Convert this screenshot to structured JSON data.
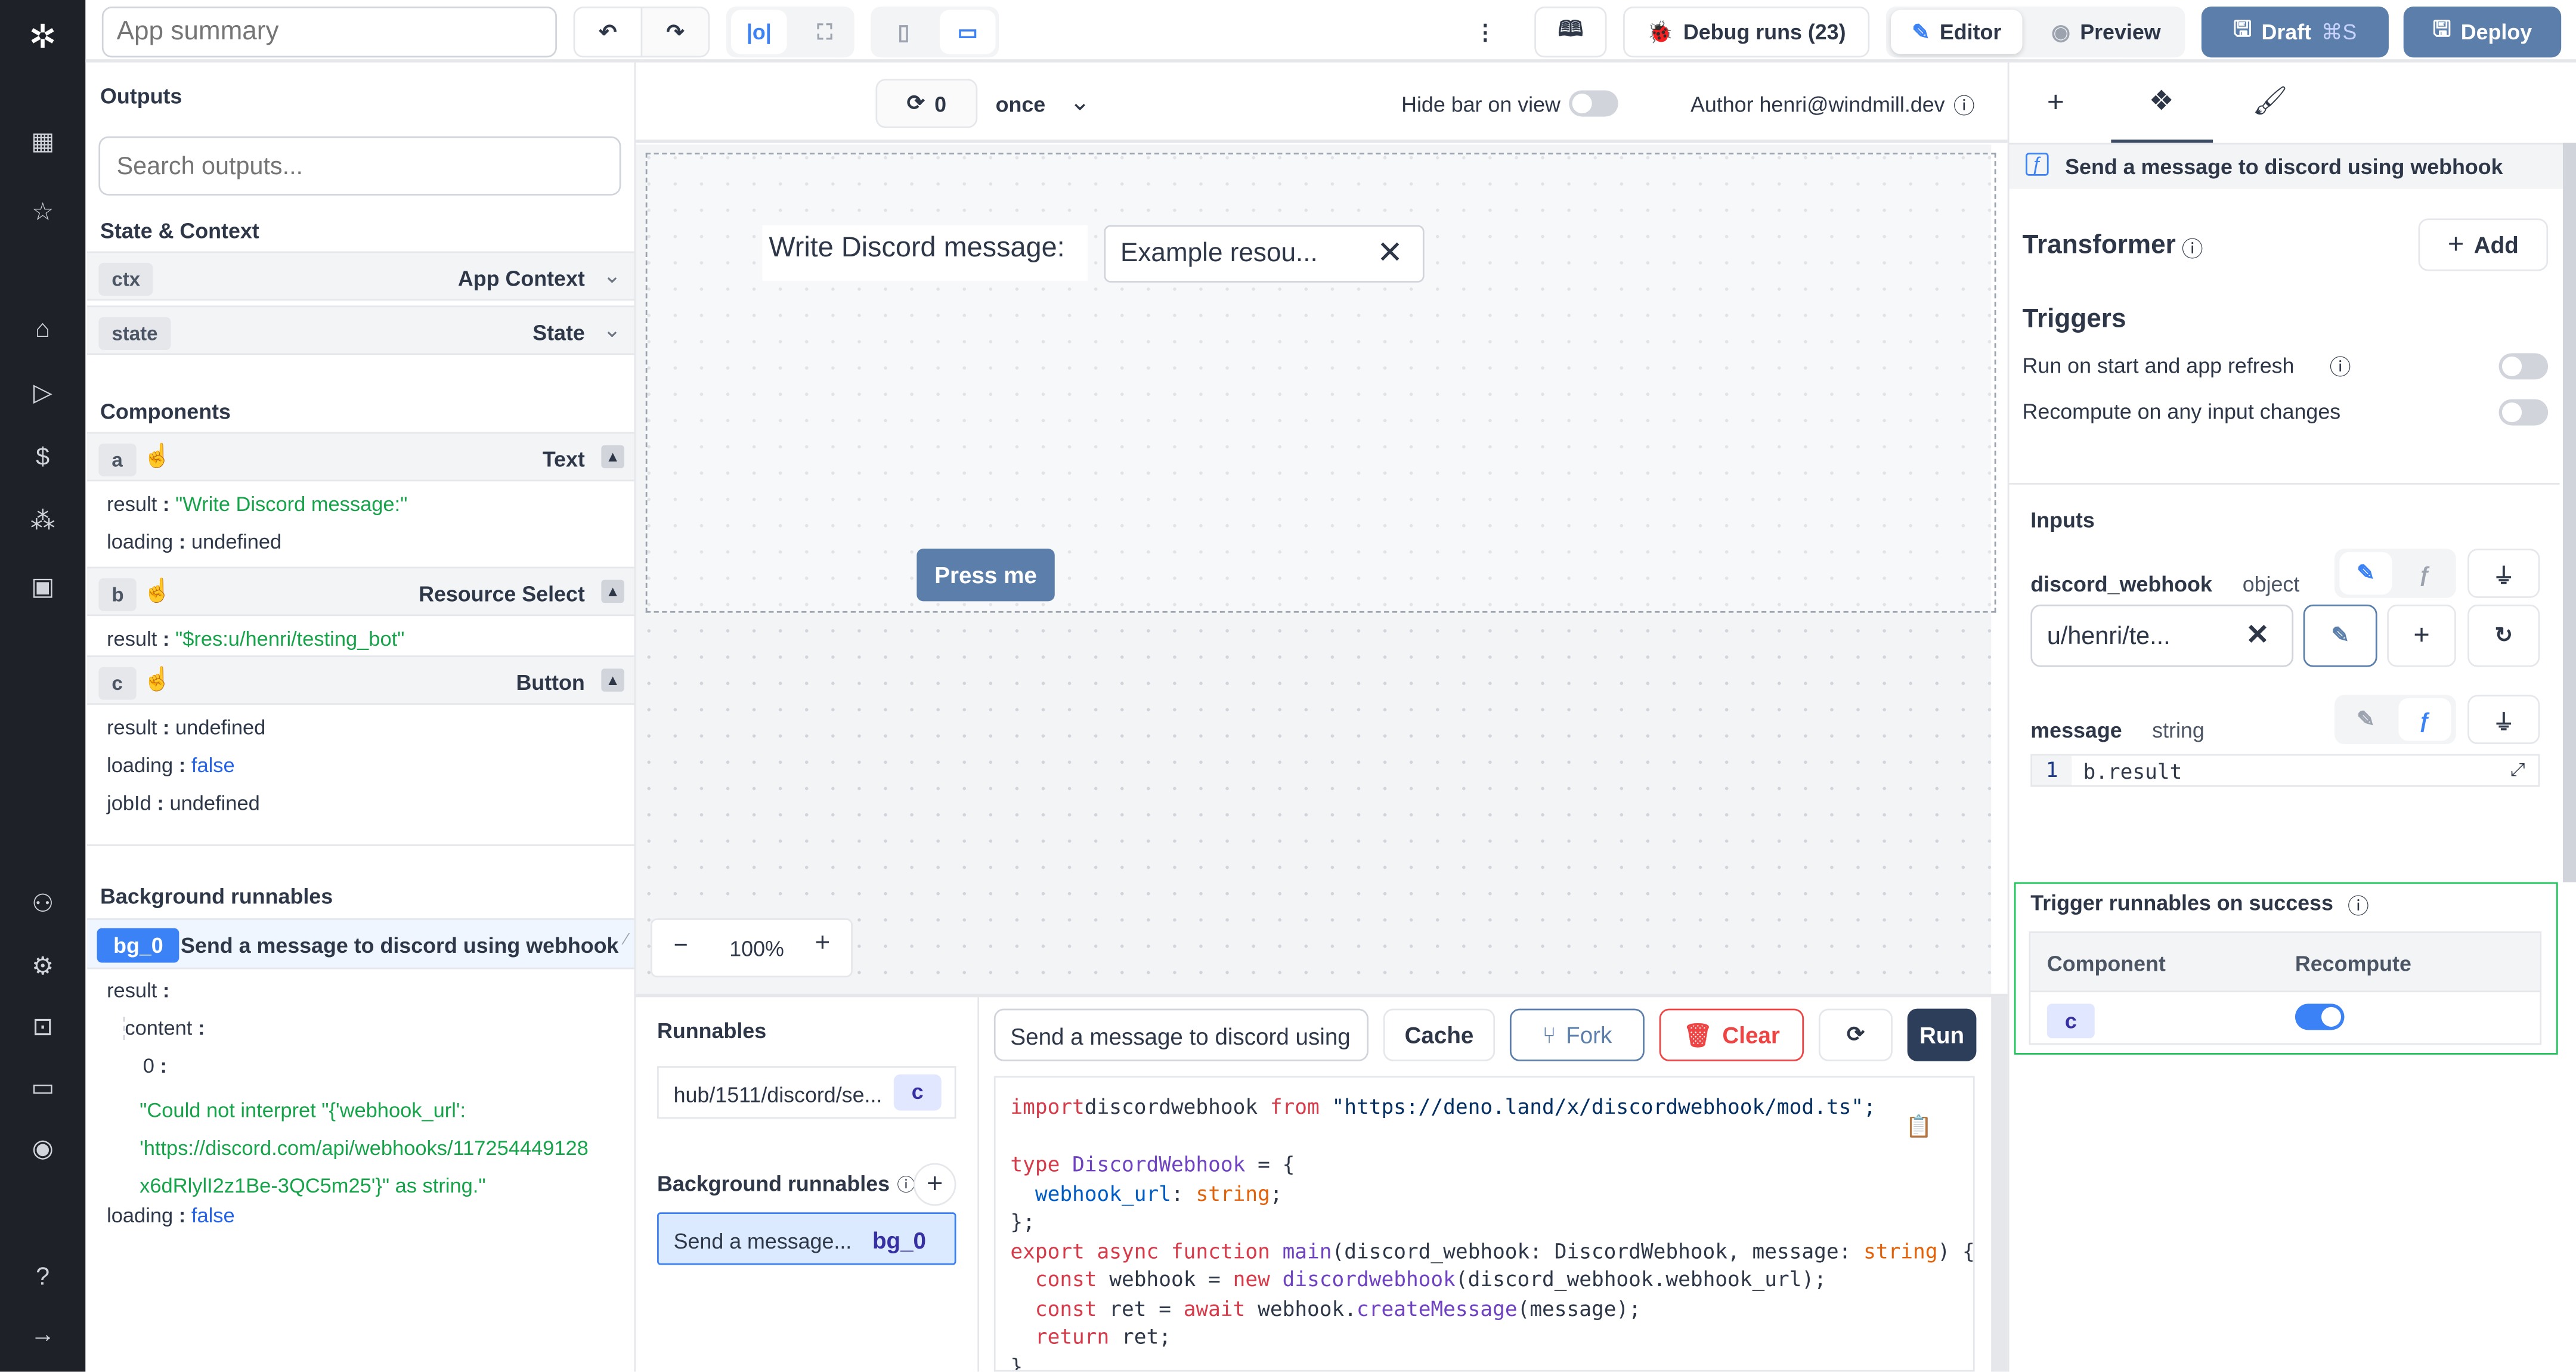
{
  "colors": {
    "accent": "#3b82f6",
    "draft": "#5b7faa",
    "nav_bg": "#1f2128",
    "success_border": "#22c55e",
    "danger": "#ef4444"
  },
  "topbar": {
    "app_summary_placeholder": "App summary",
    "debug_runs": "Debug runs (23)",
    "editor": "Editor",
    "preview": "Preview",
    "draft": "Draft",
    "draft_shortcut": "⌘S",
    "deploy": "Deploy"
  },
  "outputs": {
    "title": "Outputs",
    "search_placeholder": "Search outputs...",
    "state_context": "State & Context",
    "ctx": {
      "id": "ctx",
      "label": "App Context"
    },
    "state": {
      "id": "state",
      "label": "State"
    },
    "components_title": "Components",
    "components": [
      {
        "id": "a",
        "type": "Text",
        "fields": [
          {
            "k": "result",
            "v": "\"Write Discord message:\"",
            "c": "green"
          },
          {
            "k": "loading",
            "v": "undefined",
            "c": ""
          }
        ]
      },
      {
        "id": "b",
        "type": "Resource Select",
        "fields": [
          {
            "k": "result",
            "v": "\"$res:u/henri/testing_bot\"",
            "c": "green"
          }
        ]
      },
      {
        "id": "c",
        "type": "Button",
        "fields": [
          {
            "k": "result",
            "v": "undefined",
            "c": ""
          },
          {
            "k": "loading",
            "v": "false",
            "c": "blue"
          },
          {
            "k": "jobId",
            "v": "undefined",
            "c": ""
          }
        ]
      }
    ],
    "bg_title": "Background runnables",
    "bg": {
      "id": "bg_0",
      "name": "Send a message to discord using webhook",
      "result_key": "result",
      "content_key": "content",
      "index_key": "0",
      "error_lines": [
        "\"Could not interpret \"{'webhook_url':",
        "'https://discord.com/api/webhooks/117254449128",
        "x6dRlylI2z1Be-3QC5m25'}\" as string.\""
      ],
      "loading_key": "loading",
      "loading_val": "false"
    }
  },
  "canvas": {
    "refresh_count": "0",
    "frequency": "once",
    "hide_bar_label": "Hide bar on view",
    "hide_bar_on": false,
    "author": "Author henri@windmill.dev",
    "text_component": "Write Discord message:",
    "resource_select": "Example resou...",
    "button_label": "Press me",
    "zoom": "100%"
  },
  "runnables": {
    "title": "Runnables",
    "items": [
      {
        "name": "hub/1511/discord/se...",
        "id": "c"
      }
    ],
    "bg_title": "Background runnables",
    "bg_items": [
      {
        "name": "Send a message...",
        "id": "bg_0"
      }
    ]
  },
  "editor": {
    "script_name": "Send a message to discord using",
    "cache": "Cache",
    "fork": "Fork",
    "clear": "Clear",
    "run": "Run",
    "code": [
      [
        [
          "kw",
          "import"
        ],
        [
          "",
          "discordwebhook "
        ],
        [
          "kw",
          "from"
        ],
        [
          "st",
          " \"https://deno.land/x/discordwebhook/mod.ts\";"
        ]
      ],
      [],
      [
        [
          "kw",
          "type "
        ],
        [
          "ty",
          "DiscordWebhook"
        ],
        [
          "",
          " = {"
        ]
      ],
      [
        [
          "pr",
          "  webhook_url"
        ],
        [
          "",
          ": "
        ],
        [
          "or",
          "string"
        ],
        [
          "",
          ";"
        ]
      ],
      [
        [
          "",
          "};"
        ]
      ],
      [
        [
          "kw",
          "export async function "
        ],
        [
          "ty",
          "main"
        ],
        [
          "",
          "(discord_webhook: DiscordWebhook, message: "
        ],
        [
          "or",
          "string"
        ],
        [
          "",
          ") {"
        ]
      ],
      [
        [
          "kw",
          "  const "
        ],
        [
          "",
          "webhook = "
        ],
        [
          "kw",
          "new "
        ],
        [
          "ty",
          "discordwebhook"
        ],
        [
          "",
          "(discord_webhook.webhook_url);"
        ]
      ],
      [
        [
          "kw",
          "  const "
        ],
        [
          "",
          "ret = "
        ],
        [
          "kw",
          "await "
        ],
        [
          "",
          "webhook."
        ],
        [
          "ty",
          "createMessage"
        ],
        [
          "",
          "(message);"
        ]
      ],
      [
        [
          "kw",
          "  return "
        ],
        [
          "",
          "ret;"
        ]
      ],
      [
        [
          "",
          "}"
        ]
      ]
    ]
  },
  "panel": {
    "header": "Send a message to discord using webhook",
    "transformer": "Transformer",
    "add": "Add",
    "triggers": "Triggers",
    "run_on_start": "Run on start and app refresh",
    "run_on_start_on": false,
    "recompute_on_change": "Recompute on any input changes",
    "recompute_on_change_on": false,
    "inputs_title": "Inputs",
    "discord_webhook": {
      "name": "discord_webhook",
      "type": "object",
      "value": "u/henri/te..."
    },
    "message": {
      "name": "message",
      "type": "string",
      "line": "1",
      "expr": "b.result"
    },
    "trigger_title": "Trigger runnables on success",
    "table_headers": [
      "Component",
      "Recompute"
    ],
    "table_rows": [
      {
        "component": "c",
        "recompute": true
      }
    ]
  }
}
